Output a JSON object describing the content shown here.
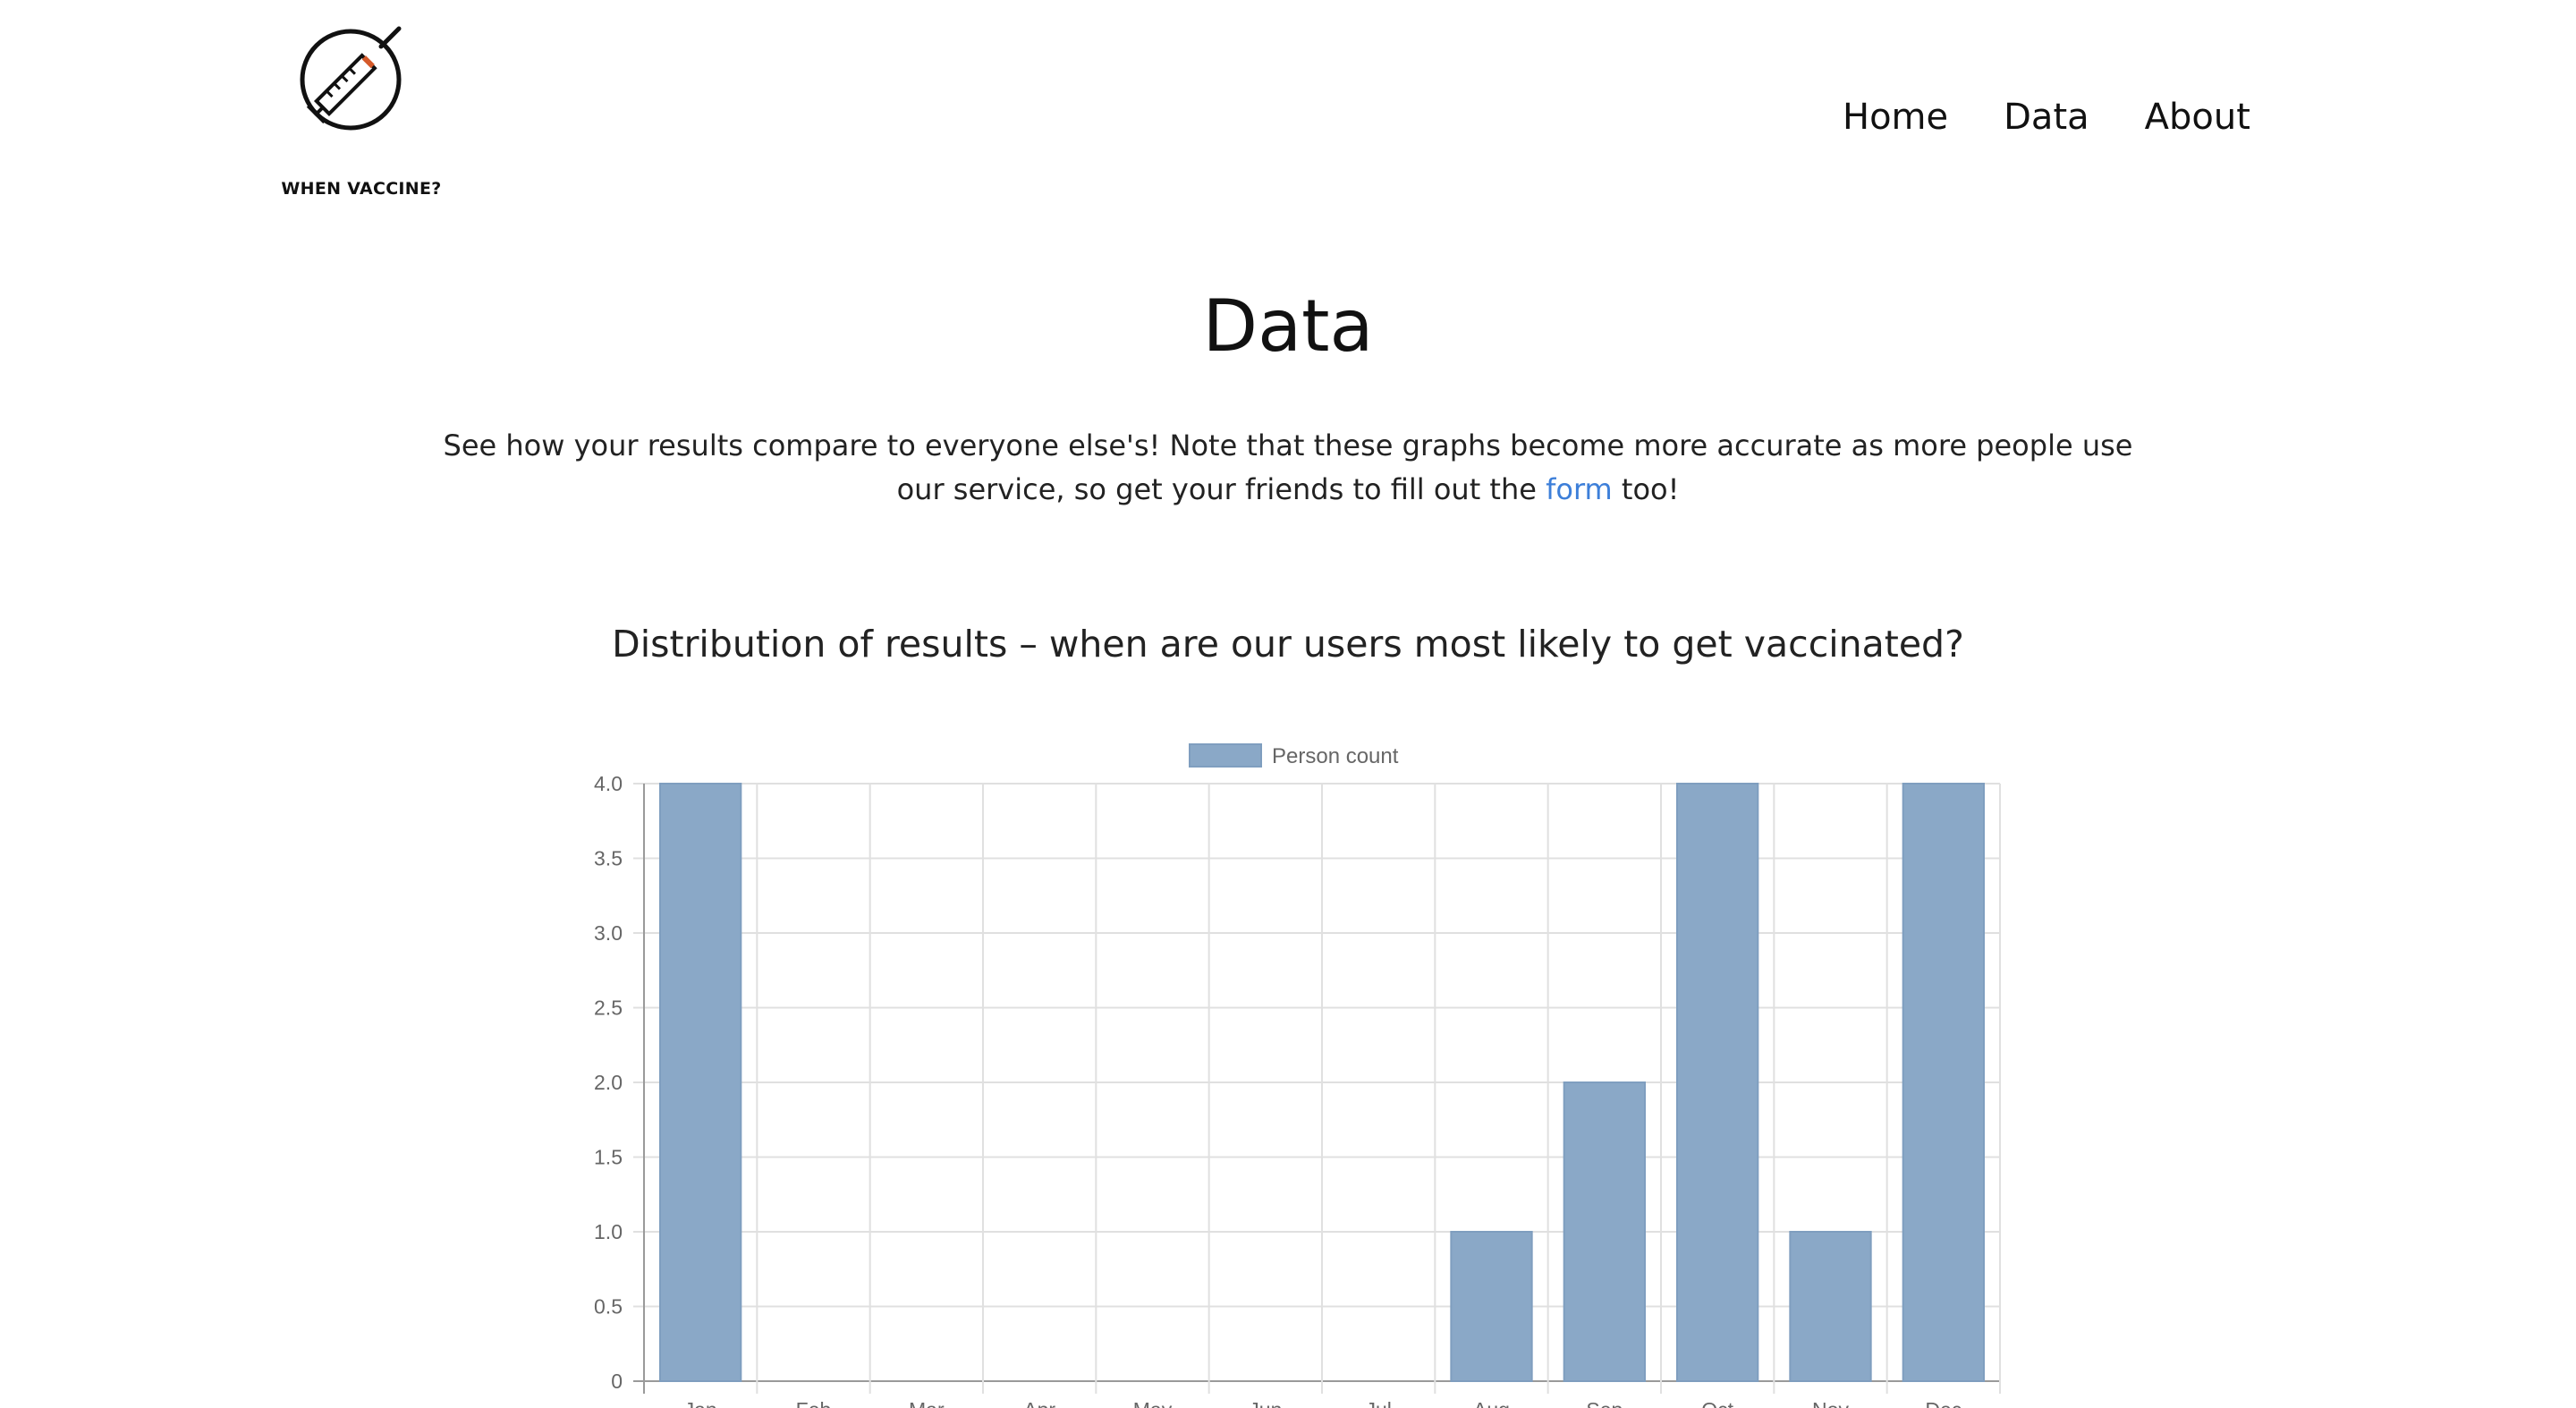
{
  "brand": {
    "name": "WHEN VACCINE?",
    "logo_icon": "syringe-in-circle-icon"
  },
  "nav": {
    "items": [
      {
        "label": "Home"
      },
      {
        "label": "Data"
      },
      {
        "label": "About"
      }
    ]
  },
  "page": {
    "title": "Data",
    "intro_before": "See how your results compare to everyone else's! Note that these graphs become more accurate as more people use our service, so get your friends to fill out the ",
    "intro_link": "form",
    "intro_after": " too!"
  },
  "colors": {
    "bar_fill": "#8aa8c7",
    "bar_stroke": "#7f9ebf",
    "grid": "#e0e0e0",
    "link": "#3d7fd9"
  },
  "chart_data": {
    "type": "bar",
    "title": "Distribution of results – when are our users most likely to get vaccinated?",
    "categories": [
      "Jan",
      "Feb",
      "Mar",
      "Apr",
      "May",
      "Jun",
      "Jul",
      "Aug",
      "Sep",
      "Oct",
      "Nov",
      "Dec"
    ],
    "series": [
      {
        "name": "Person count",
        "values": [
          4,
          0,
          0,
          0,
          0,
          0,
          0,
          1,
          2,
          4,
          1,
          4
        ]
      }
    ],
    "yticks": [
      "0",
      "0.5",
      "1.0",
      "1.5",
      "2.0",
      "2.5",
      "3.0",
      "3.5",
      "4.0"
    ],
    "ylim": [
      0,
      4
    ],
    "grid": true,
    "legend": "top"
  }
}
